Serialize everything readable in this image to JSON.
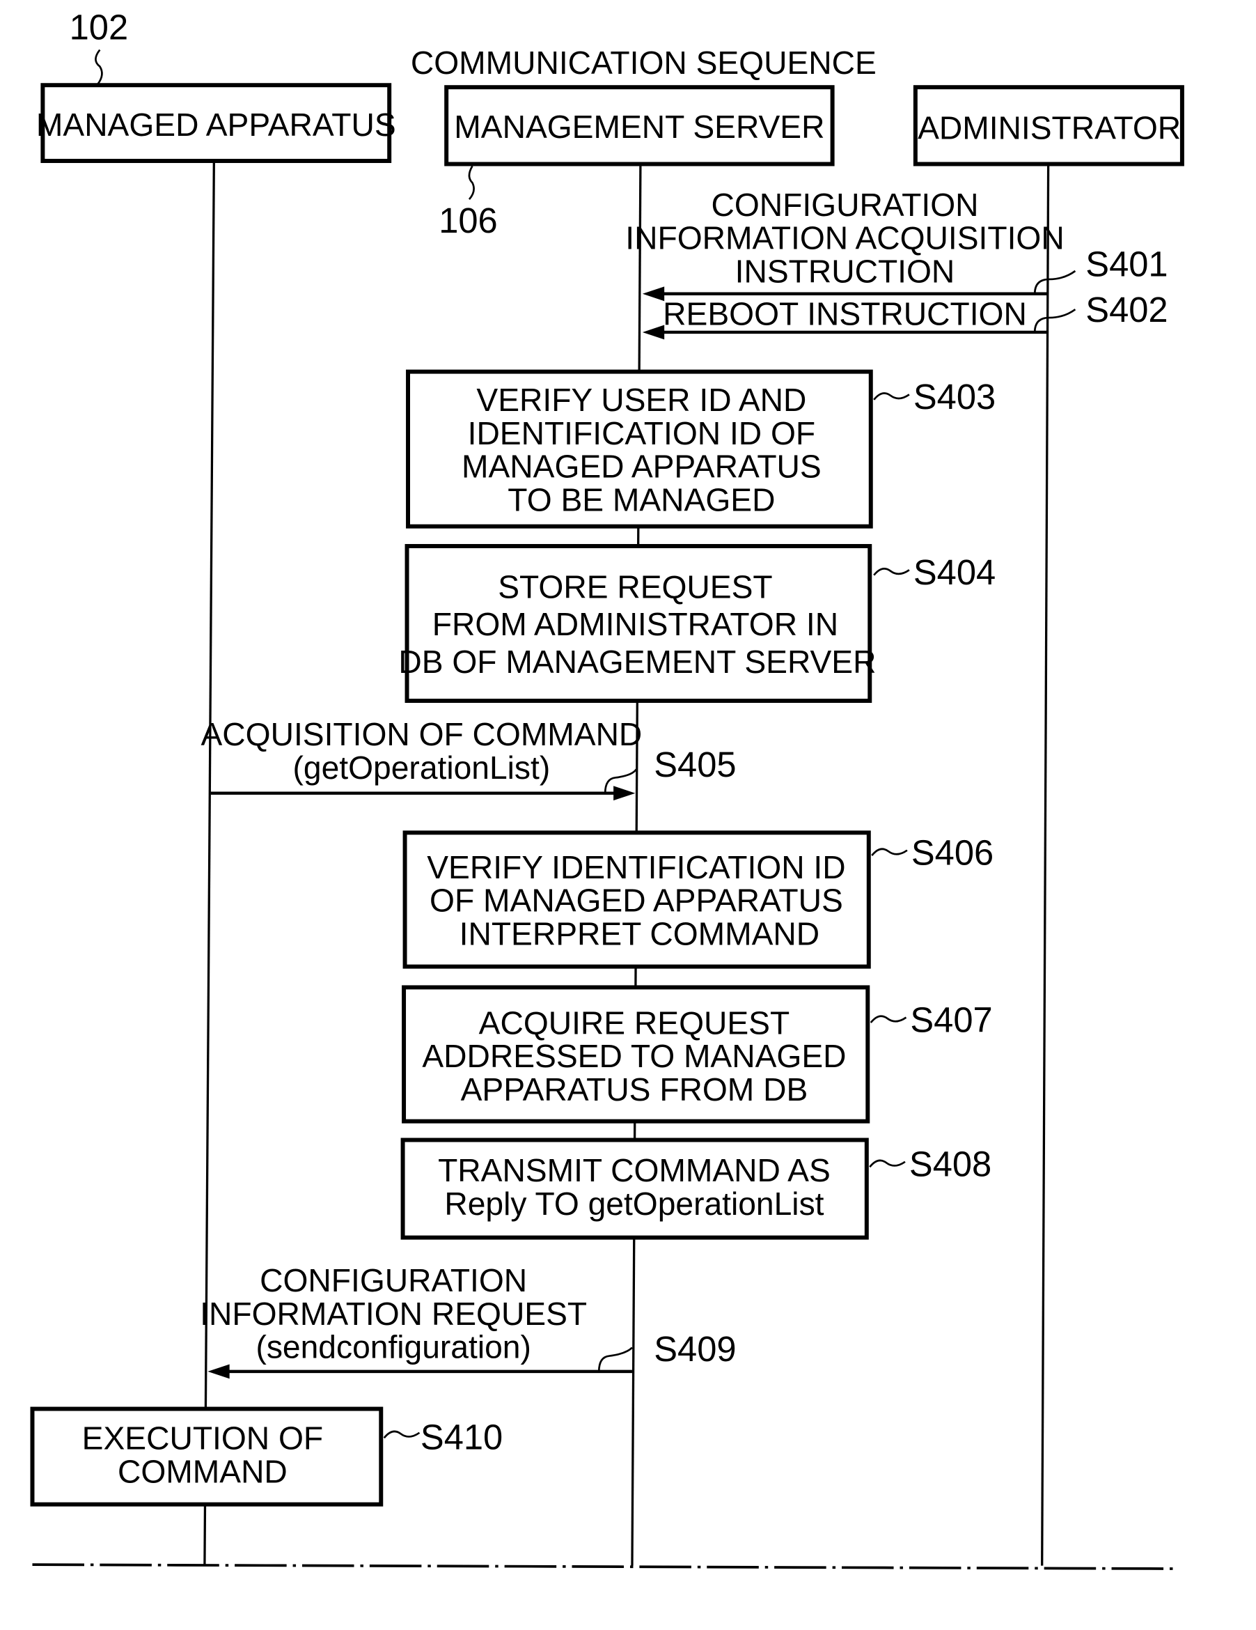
{
  "title": "COMMUNICATION SEQUENCE",
  "participants": [
    {
      "label": "MANAGED APPARATUS",
      "ref": "102"
    },
    {
      "label": "MANAGEMENT SERVER",
      "ref": "106"
    },
    {
      "label": "ADMINISTRATOR",
      "ref": ""
    }
  ],
  "messages": [
    {
      "step": "S401",
      "lines": [
        "CONFIGURATION",
        "INFORMATION ACQUISITION",
        "INSTRUCTION"
      ],
      "from": "ADMINISTRATOR",
      "to": "MANAGEMENT SERVER"
    },
    {
      "step": "S402",
      "lines": [
        "REBOOT INSTRUCTION"
      ],
      "from": "ADMINISTRATOR",
      "to": "MANAGEMENT SERVER"
    },
    {
      "step": "S405",
      "lines": [
        "ACQUISITION OF COMMAND",
        "(getOperationList)"
      ],
      "from": "MANAGED APPARATUS",
      "to": "MANAGEMENT SERVER"
    },
    {
      "step": "S409",
      "lines": [
        "CONFIGURATION",
        "INFORMATION REQUEST",
        "(sendconfiguration)"
      ],
      "from": "MANAGEMENT SERVER",
      "to": "MANAGED APPARATUS"
    }
  ],
  "processes": [
    {
      "step": "S403",
      "lines": [
        "VERIFY USER ID AND",
        "IDENTIFICATION ID OF",
        "MANAGED APPARATUS",
        "TO BE MANAGED"
      ]
    },
    {
      "step": "S404",
      "lines": [
        "STORE REQUEST",
        "FROM ADMINISTRATOR IN",
        "DB OF MANAGEMENT SERVER"
      ]
    },
    {
      "step": "S406",
      "lines": [
        "VERIFY IDENTIFICATION ID",
        "OF MANAGED APPARATUS",
        "INTERPRET COMMAND"
      ]
    },
    {
      "step": "S407",
      "lines": [
        "ACQUIRE REQUEST",
        "ADDRESSED TO MANAGED",
        "APPARATUS FROM DB"
      ]
    },
    {
      "step": "S408",
      "lines": [
        "TRANSMIT COMMAND AS",
        "Reply TO getOperationList"
      ]
    },
    {
      "step": "S410",
      "lines": [
        "EXECUTION OF",
        "COMMAND"
      ]
    }
  ]
}
